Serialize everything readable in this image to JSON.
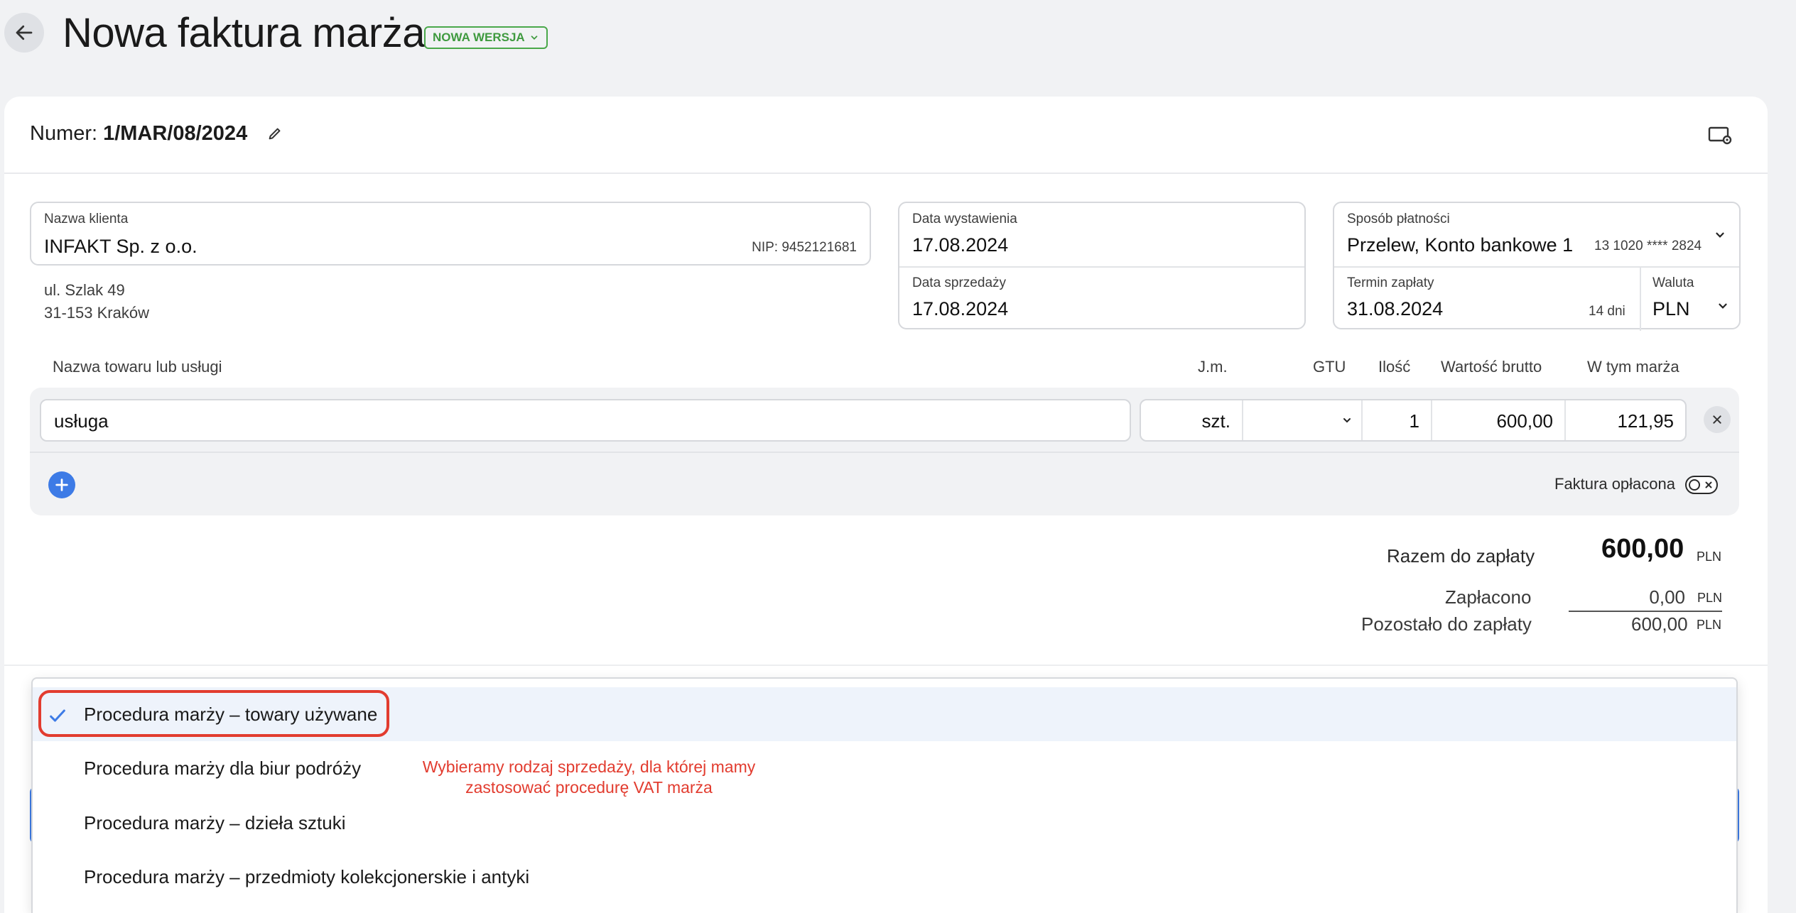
{
  "header": {
    "title": "Nowa faktura marża",
    "version_badge": "NOWA WERSJA"
  },
  "invoice": {
    "number_label": "Numer:",
    "number_value": "1/MAR/08/2024"
  },
  "client": {
    "label": "Nazwa klienta",
    "name": "INFAKT Sp. z o.o.",
    "nip": "NIP: 9452121681",
    "address_line1": "ul. Szlak 49",
    "address_line2": "31-153 Kraków"
  },
  "dates": {
    "issue_label": "Data wystawienia",
    "issue_value": "17.08.2024",
    "sale_label": "Data sprzedaży",
    "sale_value": "17.08.2024"
  },
  "payment": {
    "method_label": "Sposób płatności",
    "method_value": "Przelew, Konto bankowe 1",
    "account": "13 1020 **** 2824",
    "due_label": "Termin zapłaty",
    "due_value": "31.08.2024",
    "due_days": "14 dni",
    "currency_label": "Waluta",
    "currency_value": "PLN"
  },
  "items_table": {
    "headers": {
      "name": "Nazwa towaru lub usługi",
      "unit": "J.m.",
      "gtu": "GTU",
      "qty": "Ilość",
      "gross": "Wartość brutto",
      "margin": "W tym marża"
    },
    "rows": [
      {
        "name": "usługa",
        "unit": "szt.",
        "gtu": "",
        "qty": "1",
        "gross": "600,00",
        "margin": "121,95"
      }
    ]
  },
  "paid_toggle": {
    "label": "Faktura opłacona",
    "on": false
  },
  "totals": {
    "total_label": "Razem do zapłaty",
    "total_value": "600,00",
    "paid_label": "Zapłacono",
    "paid_value": "0,00",
    "remaining_label": "Pozostało do zapłaty",
    "remaining_value": "600,00",
    "currency": "PLN"
  },
  "procedure_dropdown": {
    "options": [
      {
        "label": "Procedura marży – towary używane",
        "selected": true
      },
      {
        "label": "Procedura marży dla biur podróży",
        "selected": false
      },
      {
        "label": "Procedura marży – dzieła sztuki",
        "selected": false
      },
      {
        "label": "Procedura marży – przedmioty kolekcjonerskie i antyki",
        "selected": false
      }
    ]
  },
  "annotation": {
    "line1": "Wybieramy rodzaj sprzedaży, dla której mamy",
    "line2": "zastosować procedurę VAT marża"
  },
  "colors": {
    "accent": "#3d7be6",
    "badge_green": "#3f9a3f",
    "annotation_red": "#e23c2f"
  }
}
